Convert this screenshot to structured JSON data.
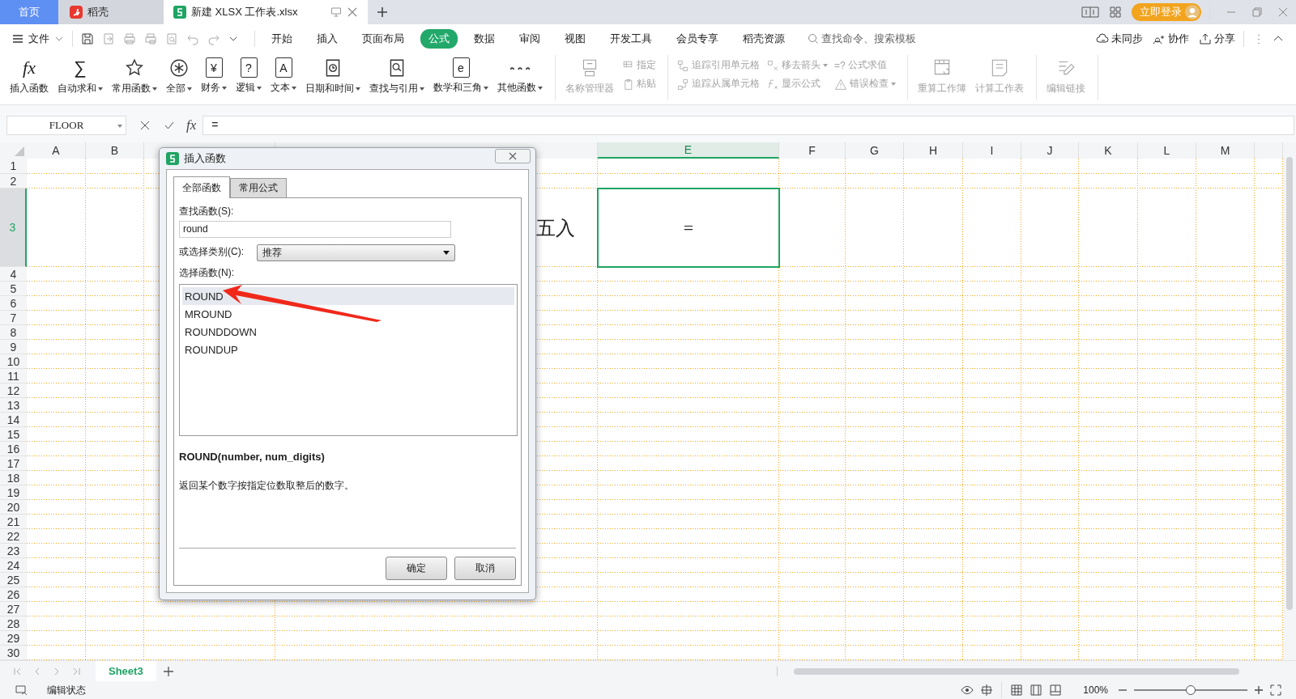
{
  "tabs": [
    {
      "label": "首页",
      "selected": false
    },
    {
      "label": "稻壳",
      "selected": false
    },
    {
      "label": "新建 XLSX 工作表.xlsx",
      "selected": true
    }
  ],
  "login": "立即登录",
  "menu": {
    "file": "文件",
    "tabs": [
      {
        "label": "开始",
        "selected": false
      },
      {
        "label": "插入",
        "selected": false
      },
      {
        "label": "页面布局",
        "selected": false
      },
      {
        "label": "公式",
        "selected": true
      },
      {
        "label": "数据",
        "selected": false
      },
      {
        "label": "审阅",
        "selected": false
      },
      {
        "label": "视图",
        "selected": false
      },
      {
        "label": "开发工具",
        "selected": false
      },
      {
        "label": "会员专享",
        "selected": false
      },
      {
        "label": "稻壳资源",
        "selected": false
      }
    ],
    "search_placeholder": "查找命令、搜索模板",
    "actions": [
      "未同步",
      "协作",
      "分享"
    ]
  },
  "ribbon": {
    "functions": [
      {
        "label": "插入函数",
        "glyph": "fx",
        "dropdown": false
      },
      {
        "label": "自动求和",
        "glyph": "∑",
        "dropdown": true
      },
      {
        "label": "常用函数",
        "dropdown": true
      },
      {
        "label": "全部",
        "dropdown": true
      },
      {
        "label": "财务",
        "glyph": "¥",
        "dropdown": true
      },
      {
        "label": "逻辑",
        "glyph": "?",
        "dropdown": true
      },
      {
        "label": "文本",
        "glyph": "A",
        "dropdown": true
      },
      {
        "label": "日期和时间",
        "dropdown": true
      },
      {
        "label": "查找与引用",
        "dropdown": true
      },
      {
        "label": "数学和三角",
        "glyph": "e",
        "dropdown": true
      },
      {
        "label": "其他函数",
        "dropdown": true
      }
    ],
    "name_manager": {
      "label": "名称管理器",
      "disabled": true
    },
    "small_columns": [
      [
        {
          "label": "指定",
          "dropdown": false,
          "disabled": true
        },
        {
          "label": "粘贴",
          "dropdown": false,
          "disabled": true
        }
      ],
      [
        {
          "label": "追踪引用单元格",
          "dropdown": false,
          "disabled": true
        },
        {
          "label": "追踪从属单元格",
          "dropdown": false,
          "disabled": true
        }
      ],
      [
        {
          "label": "移去箭头",
          "dropdown": true,
          "disabled": true
        },
        {
          "label": "显示公式",
          "dropdown": false,
          "disabled": true
        }
      ],
      [
        {
          "label": "公式求值",
          "glyph": "=?",
          "dropdown": false,
          "disabled": true
        },
        {
          "label": "错误检查",
          "dropdown": true,
          "disabled": true
        }
      ]
    ],
    "calc": [
      {
        "label": "重算工作簿",
        "disabled": true
      },
      {
        "label": "计算工作表",
        "disabled": true
      }
    ],
    "links": {
      "label": "编辑链接",
      "disabled": true
    }
  },
  "formula_bar": {
    "name_box": "FLOOR",
    "fx": "fx",
    "value": "="
  },
  "columns": [
    {
      "label": "A",
      "selected": false
    },
    {
      "label": "B",
      "selected": false
    },
    {
      "selected": false
    },
    {
      "selected": false
    },
    {
      "label": "E",
      "selected": true
    },
    {
      "label": "F",
      "selected": false
    },
    {
      "label": "G",
      "selected": false
    },
    {
      "label": "H",
      "selected": false
    },
    {
      "label": "I",
      "selected": false
    },
    {
      "label": "J",
      "selected": false
    },
    {
      "label": "K",
      "selected": false
    },
    {
      "label": "L",
      "selected": false
    },
    {
      "label": "M",
      "selected": false
    },
    {
      "selected": false
    }
  ],
  "rows": [
    {
      "label": "1",
      "selected": false
    },
    {
      "label": "2",
      "selected": false
    },
    {
      "label": "3",
      "selected": true,
      "cells": [
        {
          "text": "五入",
          "selected": false
        },
        {
          "text": "=",
          "selected": true
        }
      ]
    },
    {
      "label": "4",
      "selected": false
    },
    {
      "label": "5",
      "selected": false
    },
    {
      "label": "6",
      "selected": false
    },
    {
      "label": "7",
      "selected": false
    },
    {
      "label": "8",
      "selected": false
    },
    {
      "label": "9",
      "selected": false
    },
    {
      "label": "10",
      "selected": false
    },
    {
      "label": "11",
      "selected": false
    },
    {
      "label": "12",
      "selected": false
    },
    {
      "label": "13",
      "selected": false
    },
    {
      "label": "14",
      "selected": false
    },
    {
      "label": "15",
      "selected": false
    },
    {
      "label": "16",
      "selected": false
    },
    {
      "label": "17",
      "selected": false
    },
    {
      "label": "18",
      "selected": false
    },
    {
      "label": "19",
      "selected": false
    },
    {
      "label": "20",
      "selected": false
    },
    {
      "label": "21",
      "selected": false
    },
    {
      "label": "22",
      "selected": false
    },
    {
      "label": "23",
      "selected": false
    },
    {
      "label": "24",
      "selected": false
    },
    {
      "label": "25",
      "selected": false
    },
    {
      "label": "26",
      "selected": false
    },
    {
      "label": "27",
      "selected": false
    },
    {
      "label": "28",
      "selected": false
    },
    {
      "label": "29",
      "selected": false
    },
    {
      "label": "30",
      "selected": false
    }
  ],
  "dialog": {
    "title": "插入函数",
    "tabs": [
      {
        "label": "全部函数",
        "selected": true
      },
      {
        "label": "常用公式",
        "selected": false
      }
    ],
    "search_label": "查找函数(S):",
    "search_value": "round",
    "category_label": "或选择类别(C):",
    "category_value": "推荐",
    "list_label": "选择函数(N):",
    "functions": [
      {
        "name": "ROUND",
        "selected": true
      },
      {
        "name": "MROUND",
        "selected": false
      },
      {
        "name": "ROUNDDOWN",
        "selected": false
      },
      {
        "name": "ROUNDUP",
        "selected": false
      }
    ],
    "syntax": "ROUND(number, num_digits)",
    "description": "返回某个数字按指定位数取整后的数字。",
    "buttons": [
      "确定",
      "取消"
    ]
  },
  "sheet_tabs": [
    {
      "label": "Sheet3",
      "selected": true
    }
  ],
  "status": {
    "mode": "编辑状态",
    "zoom": "100%",
    "zoom_slider": {
      "level": 0.5
    }
  }
}
